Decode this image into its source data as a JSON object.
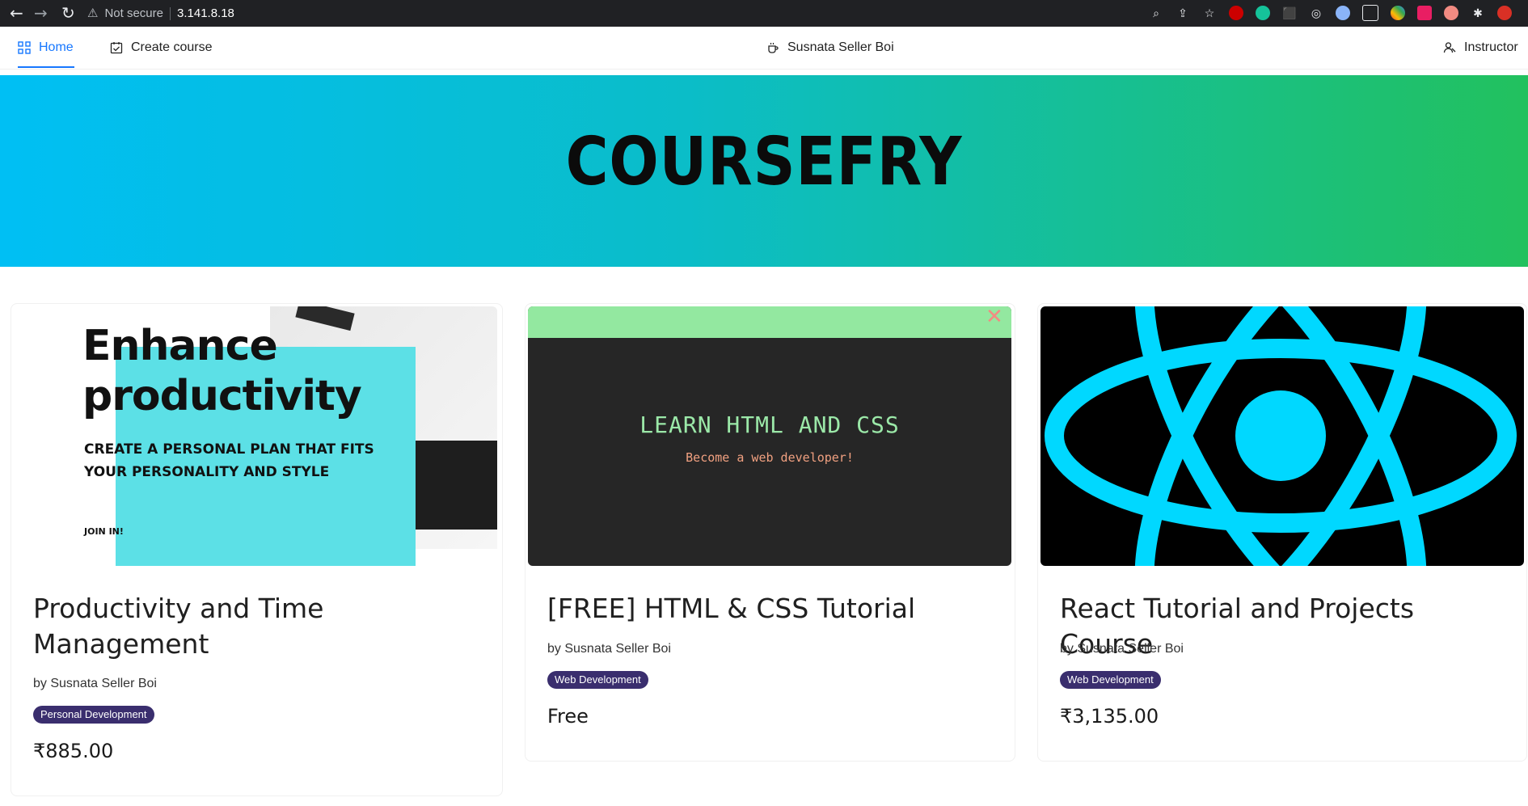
{
  "browser": {
    "security_label": "Not secure",
    "url": "3.141.8.18"
  },
  "nav": {
    "home": "Home",
    "create_course": "Create course",
    "user": "Susnata Seller Boi",
    "instructor": "Instructor"
  },
  "hero": {
    "title": "COURSEFRY"
  },
  "courses": [
    {
      "title": "Productivity and Time Management",
      "author": "by Susnata Seller Boi",
      "category": "Personal Development",
      "price": "₹885.00",
      "thumb": {
        "heading_1": "Enhance",
        "heading_2": "productivity",
        "sub_1": "CREATE A PERSONAL PLAN THAT FITS",
        "sub_2": "YOUR PERSONALITY AND STYLE",
        "cta": "JOIN IN!"
      }
    },
    {
      "title": "[FREE] HTML & CSS Tutorial",
      "author": "by Susnata Seller Boi",
      "category": "Web Development",
      "price": "Free",
      "thumb": {
        "heading": "LEARN HTML AND CSS",
        "sub": "Become a web developer!"
      }
    },
    {
      "title": "React Tutorial and Projects Course",
      "author": "by Susnata Seller Boi",
      "category": "Web Development",
      "price": "₹3,135.00",
      "thumb": {}
    }
  ],
  "colors": {
    "accent": "#1677ff",
    "tag_bg": "#3a2e6e",
    "hero_start": "#00bff4",
    "hero_end": "#22c15e",
    "react_blue": "#00d8ff"
  }
}
